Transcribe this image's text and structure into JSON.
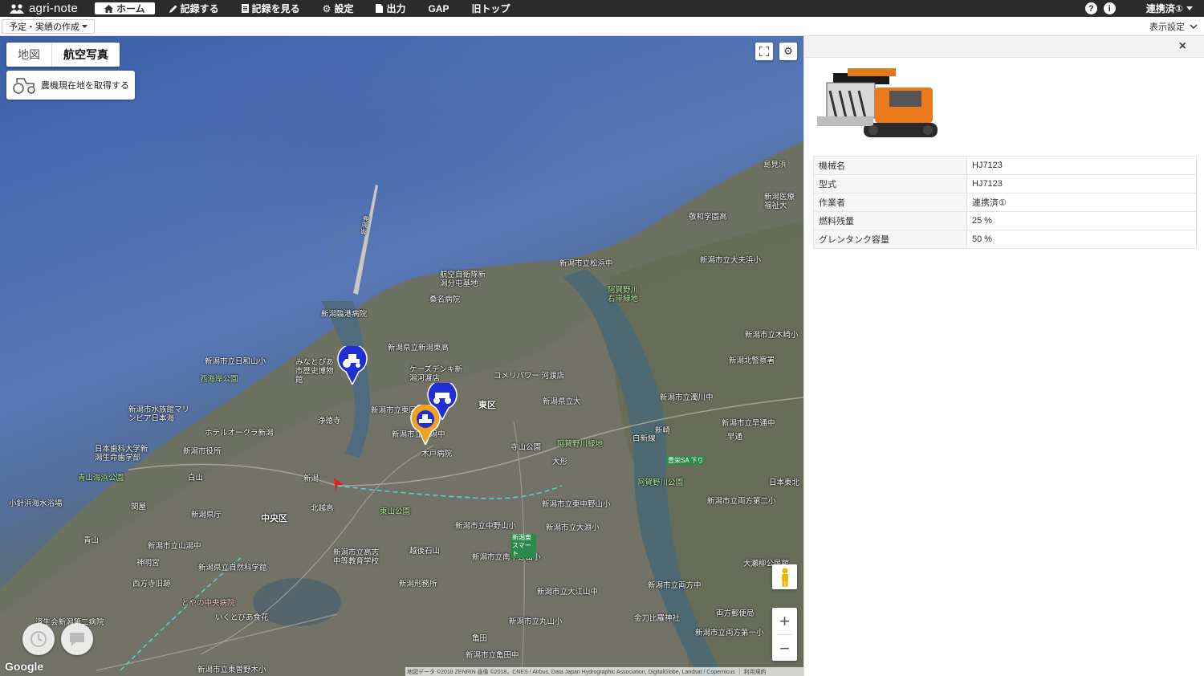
{
  "app": {
    "logo": "agri-note"
  },
  "nav": {
    "items": [
      {
        "label": "ホーム",
        "icon": "home-icon"
      },
      {
        "label": "記録する",
        "icon": "pencil-icon"
      },
      {
        "label": "記録を見る",
        "icon": "document-icon"
      },
      {
        "label": "設定",
        "icon": "gear-icon"
      },
      {
        "label": "出力",
        "icon": "file-icon"
      },
      {
        "label": "GAP"
      },
      {
        "label": "旧トップ"
      }
    ],
    "help": "?",
    "info": "i",
    "user": "連携済①"
  },
  "subbar": {
    "plan_button": "予定・実績の作成",
    "display_settings": "表示設定"
  },
  "map": {
    "tabs": [
      "地図",
      "航空写真"
    ],
    "active_tab": "航空写真",
    "locate_button": "農機現在地を取得する",
    "zoom_in": "+",
    "zoom_out": "−",
    "google": "Google",
    "attribution": "地図データ ©2018 ZENRIN 画像 ©2018，CNES / Airbus, Data Japan Hydrographic Association, DigitalGlobe, Landsat / Copernicus ｜ 利用規約",
    "places": [
      "新潟港",
      "航空自衛隊新潟分屯基地",
      "桑名病院",
      "新潟臨港病院",
      "新潟県立新潟東高",
      "新潟市立日和山小",
      "みなとぴあ市歴史博物館",
      "西海岸公園",
      "ケーズデンキ新潟河渡店",
      "コメリパワー 河渡店",
      "新潟市立松浜中",
      "阿賀野川右岸緑地",
      "東区",
      "新潟県立大",
      "新潟市水族館マリンピア日本海",
      "ホテルオークラ新潟",
      "浄徳寺",
      "新潟市立東区",
      "新潟市立新潟中",
      "木戸病院",
      "寺山公園",
      "阿賀野川緑地",
      "大形",
      "日本歯科大学新潟生命歯学部",
      "新潟市役所",
      "青山海浜公園",
      "白山",
      "新潟",
      "北越高",
      "小針浜海水浴場",
      "関屋",
      "新潟県庁",
      "中央区",
      "東山公園",
      "新潟市立中野山小",
      "新潟市立東中野山小",
      "新潟市立大淵小",
      "青山",
      "新潟市立山潟中",
      "神明宮",
      "新潟県立自然科学館",
      "新潟市立高志中等教育学校",
      "越後石山",
      "新潟市立南中野山小",
      "新潟刑務所",
      "西方寺旧跡",
      "とやの中央病院",
      "いくとぴあ食花",
      "新潟市立大江山中",
      "新潟市立丸山小",
      "金刀比羅神社",
      "新潟市立両方中",
      "大瀬柳公民館",
      "両方郵便局",
      "新潟市立両方第一小",
      "済生会新潟第二病院",
      "亀田",
      "新潟市立亀田中",
      "新潟市立東曽野木小",
      "島見浜",
      "新潟医療福祉大",
      "敬和学園高",
      "新潟市立大夫浜小",
      "新潟市立木崎小",
      "新潟北警察署",
      "新潟市立濁川中",
      "新潟市立早通中",
      "早通",
      "新崎",
      "豊栄SA 下り",
      "阿賀野川公園",
      "白新線",
      "日本東北",
      "新潟市立両方第二小",
      "新潟東スマート"
    ],
    "districts": [
      "中央区",
      "東区"
    ]
  },
  "panel": {
    "close": "×",
    "image_label": "combine-harvester-image",
    "details": [
      {
        "key": "機械名",
        "value": "HJ7123"
      },
      {
        "key": "型式",
        "value": "HJ7123"
      },
      {
        "key": "作業者",
        "value": "連携済①"
      },
      {
        "key": "燃料残量",
        "value": "25 %"
      },
      {
        "key": "グレンタンク容量",
        "value": "50 %"
      }
    ]
  },
  "colors": {
    "nav_bg": "#2b2b2b",
    "marker_blue": "#1f2fd1",
    "marker_orange": "#f0a020",
    "sea": "#4c6fb4"
  }
}
